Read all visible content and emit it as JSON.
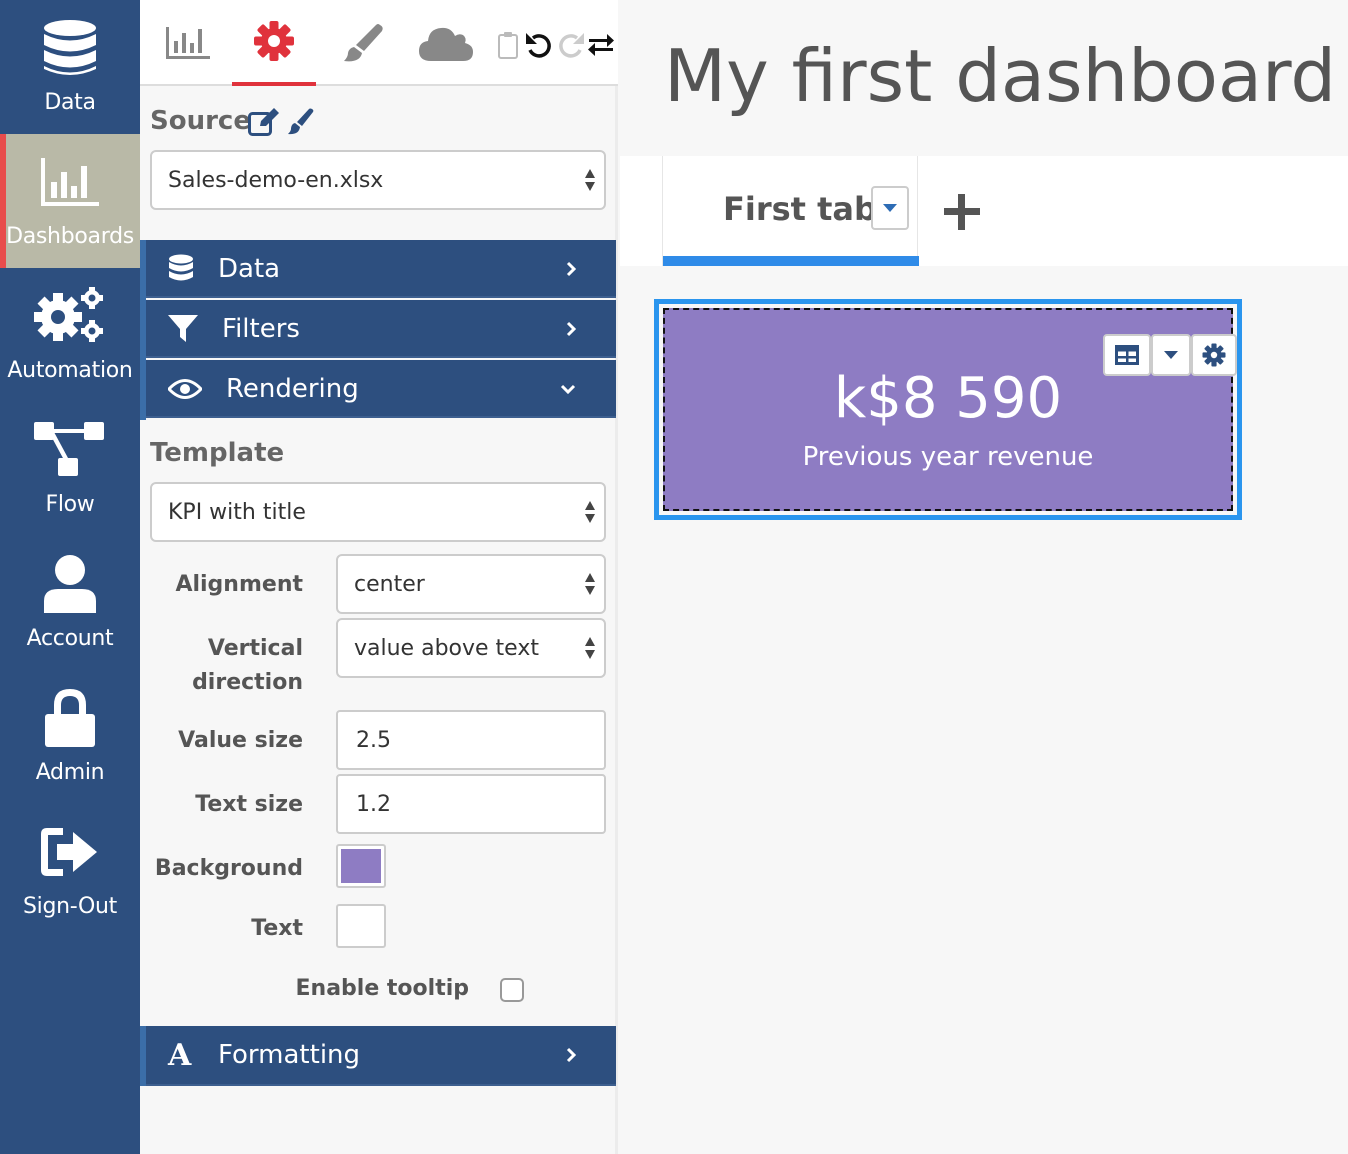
{
  "nav": {
    "items": [
      {
        "label": "Data",
        "icon": "database-icon"
      },
      {
        "label": "Dashboards",
        "icon": "bar-chart-icon",
        "active": true
      },
      {
        "label": "Automation",
        "icon": "gears-icon"
      },
      {
        "label": "Flow",
        "icon": "flow-icon"
      },
      {
        "label": "Account",
        "icon": "user-icon"
      },
      {
        "label": "Admin",
        "icon": "lock-icon"
      },
      {
        "label": "Sign-Out",
        "icon": "sign-out-icon"
      }
    ],
    "active_color": "#e84c4c"
  },
  "panel": {
    "tabs": [
      "chart-tab",
      "settings-tab",
      "style-tab",
      "cloud-tab"
    ],
    "active_tab": "settings-tab",
    "source_label": "Source",
    "source_value": "Sales-demo-en.xlsx",
    "accordions": {
      "data": "Data",
      "filters": "Filters",
      "rendering": "Rendering",
      "formatting": "Formatting"
    },
    "template_label": "Template",
    "template_value": "KPI with title",
    "fields": {
      "alignment_label": "Alignment",
      "alignment_value": "center",
      "vertical_label_1": "Vertical",
      "vertical_label_2": "direction",
      "vertical_value": "value above text",
      "value_size_label": "Value size",
      "value_size_value": "2.5",
      "text_size_label": "Text size",
      "text_size_value": "1.2",
      "background_label": "Background",
      "background_color": "#8e7cc3",
      "text_label": "Text",
      "text_color": "#ffffff",
      "tooltip_label": "Enable tooltip",
      "tooltip_checked": false
    }
  },
  "main": {
    "title": "My first dashboard",
    "tab_label": "First tab",
    "kpi_value": "k$8 590",
    "kpi_text": "Previous year revenue",
    "accent": "#2a95ee"
  }
}
